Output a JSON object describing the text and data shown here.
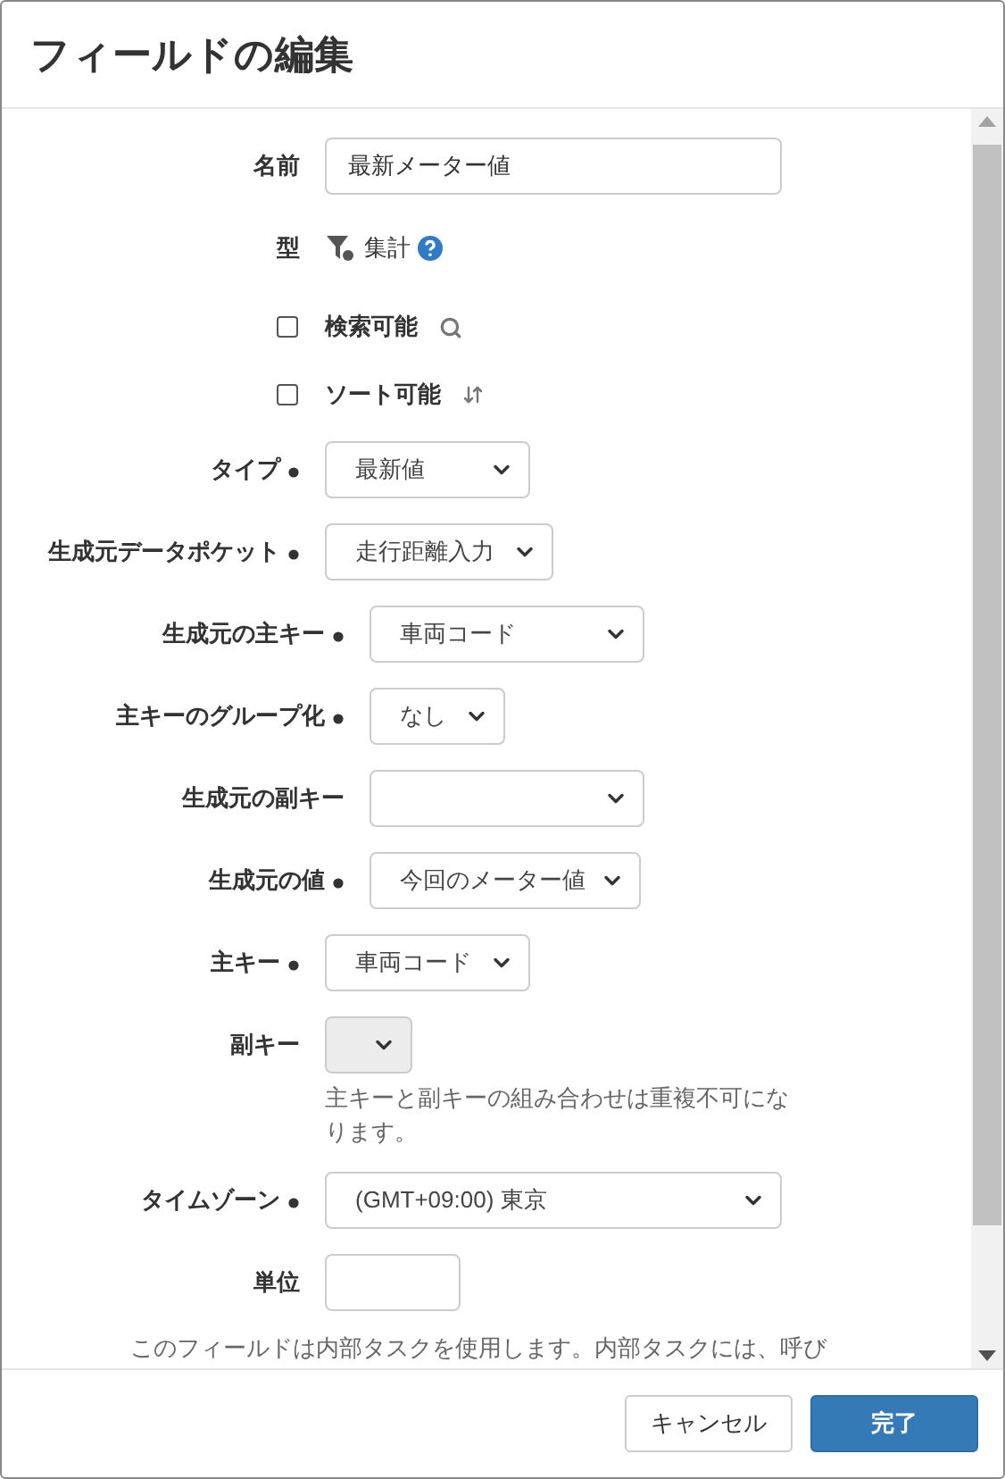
{
  "dialog": {
    "title": "フィールドの編集"
  },
  "fields": [
    {
      "kind": "text",
      "label": "名前",
      "required": false,
      "value": "最新メーター値"
    },
    {
      "kind": "info",
      "label": "型",
      "value": "集計"
    },
    {
      "kind": "checkbox",
      "label": "検索可能",
      "checked": false
    },
    {
      "kind": "checkbox",
      "label": "ソート可能",
      "checked": false
    },
    {
      "kind": "select",
      "label": "タイプ",
      "required": true,
      "value": "最新値",
      "disabled": false
    },
    {
      "kind": "select",
      "label": "生成元データポケット",
      "required": true,
      "value": "走行距離入力",
      "disabled": false,
      "children": [
        {
          "kind": "select",
          "label": "生成元の主キー",
          "required": true,
          "value": "車両コード",
          "disabled": false
        },
        {
          "kind": "select",
          "label": "主キーのグループ化",
          "required": true,
          "value": "なし",
          "disabled": false
        },
        {
          "kind": "select",
          "label": "生成元の副キー",
          "required": false,
          "disabled": false
        },
        {
          "kind": "select",
          "label": "生成元の値",
          "required": true,
          "value": "今回のメーター値",
          "disabled": false
        }
      ]
    },
    {
      "kind": "select",
      "label": "主キー",
      "required": true,
      "value": "車両コード",
      "disabled": false
    },
    {
      "kind": "select",
      "label": "副キー",
      "required": false,
      "disabled": true,
      "help": "主キーと副キーの組み合わせは重複不可になります。"
    },
    {
      "kind": "select",
      "label": "タイムゾーン",
      "required": true,
      "value": "(GMT+09:00) 東京",
      "disabled": false
    },
    {
      "kind": "text",
      "label": "単位",
      "required": false
    }
  ],
  "note": "このフィールドは内部タスクを使用します。内部タスクには、呼び",
  "buttons": [
    {
      "label": "キャンセル",
      "kind": "secondary"
    },
    {
      "label": "完了",
      "kind": "primary"
    }
  ]
}
